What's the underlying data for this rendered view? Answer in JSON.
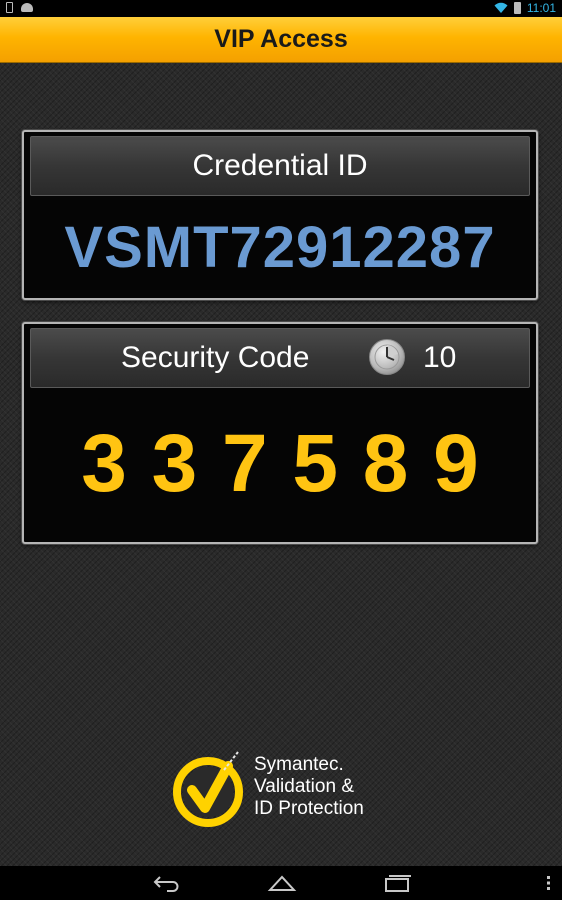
{
  "status_bar": {
    "time": "11:01",
    "icons": [
      "phone-icon",
      "android-icon",
      "wifi-icon",
      "battery-icon"
    ]
  },
  "app": {
    "title": "VIP Access"
  },
  "credential": {
    "label": "Credential ID",
    "value": "VSMT72912287"
  },
  "security": {
    "label": "Security Code",
    "timer": "10",
    "digits": [
      "3",
      "3",
      "7",
      "5",
      "8",
      "9"
    ]
  },
  "logo": {
    "lines": [
      "Symantec.",
      "Validation &",
      "ID Protection"
    ]
  },
  "nav": {
    "buttons": [
      "back-icon",
      "home-icon",
      "recent-apps-icon",
      "menu-icon"
    ]
  },
  "colors": {
    "accent": "#ffb400",
    "credential_text": "#6a9ad2",
    "code_text": "#ffc412",
    "status_blue": "#33b5e5"
  }
}
